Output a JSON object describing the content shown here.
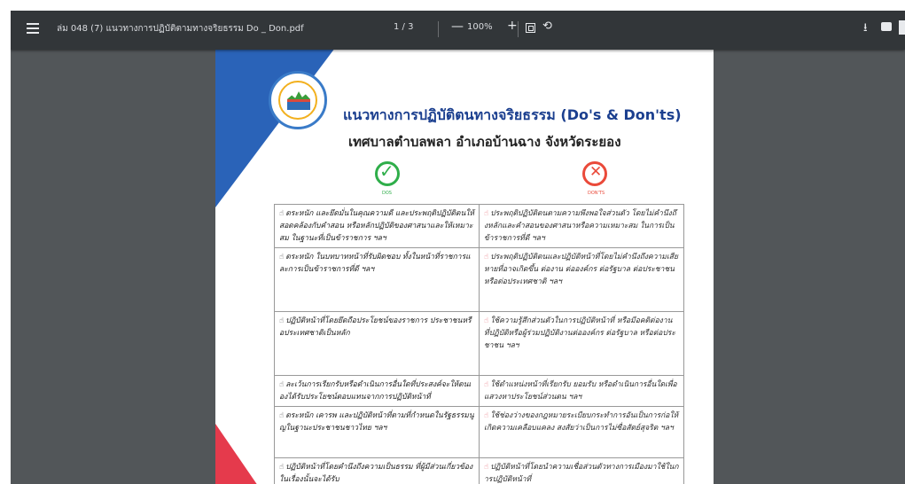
{
  "toolbar": {
    "title": "ล่ม 048 (7) แนวทางการปฏิบัติตามทางจริยธรรม Do _ Don.pdf",
    "page": "1 / 3",
    "zoom_out": "—",
    "zoom": "100%",
    "zoom_in": "+",
    "rotate": "⟲",
    "download": "⭳"
  },
  "document": {
    "title_line1": "แนวทางการปฏิบัติตนทางจริยธรรม (Do's & Don'ts)",
    "title_line2": "เทศบาลตำบลพลา  อำเภอบ้านฉาง  จังหวัดระยอง",
    "do_mark": "✓",
    "dont_mark": "✕",
    "do_label": "DOS",
    "dont_label": "DON'TS",
    "rows": [
      {
        "do": "ตระหนัก และยึดมั่นในคุณความดี และประพฤติปฏิบัติตนให้สอดคล้องกับคำสอน หรือหลักปฏิบัติของศาสนาและให้เหมาะสม ในฐานะที่เป็นข้าราชการ ฯลฯ",
        "dont": "ประพฤติปฏิบัติตนตามความพึงพอใจส่วนตัว โดยไม่คำนึงถึงหลักและคำสอนของศาสนาหรือความเหมาะสม ในการเป็นข้าราชการที่ดี ฯลฯ"
      },
      {
        "do": "ตระหนัก ในบทบาทหน้าที่รับผิดชอบ ทั้งในหน้าที่ราชการและการเป็นข้าราชการที่ดี ฯลฯ",
        "dont": "ประพฤติปฏิบัติตนและปฏิบัติหน้าที่โดยไม่คำนึงถึงความเสียหายที่อาจเกิดขึ้น ต่องาน ต่อองค์กร ต่อรัฐบาล ต่อประชาชน หรือต่อประเทศชาติ ฯลฯ"
      },
      {
        "do": "ปฏิบัติหน้าที่โดยยึดถือประโยชน์ของราชการ ประชาชนหรือประเทศชาติเป็นหลัก",
        "dont": "ใช้ความรู้สึกส่วนตัวในการปฏิบัติหน้าที่ หรือมีอคติต่องาน ที่ปฏิบัติหรือผู้ร่วมปฏิบัติงานต่อองค์กร ต่อรัฐบาล หรือต่อประชาชน ฯลฯ"
      },
      {
        "do": "ละเว้นการเรียกรับหรือดำเนินการอื่นใดที่ประสงค์จะให้ตนเองได้รับประโยชน์ตอบแทนจากการปฏิบัติหน้าที่",
        "dont": "ใช้ตำแหน่งหน้าที่เรียกรับ ยอมรับ หรือดำเนินการอื่นใดเพื่อแสวงหาประโยชน์ส่วนตน ฯลฯ"
      },
      {
        "do": "ตระหนัก เคารพ และปฏิบัติหน้าที่ตามที่กำหนดในรัฐธรรมนูญในฐานะประชาชนชาวไทย ฯลฯ",
        "dont": "ใช้ช่องว่างของกฎหมายระเบียบกระทำการอันเป็นการก่อให้เกิดความเคลือบแคลง สงสัยว่าเป็นการไม่ซื่อสัตย์สุจริต ฯลฯ"
      },
      {
        "do": "ปฏิบัติหน้าที่โดยคำนึงถึงความเป็นธรรม ที่ผู้มีส่วนเกี่ยวข้องในเรื่องนั้นจะได้รับ",
        "dont": "ปฏิบัติหน้าที่โดยนำความเชื่อส่วนตัวทางการเมืองมาใช้ในการปฏิบัติหน้าที่"
      }
    ]
  }
}
